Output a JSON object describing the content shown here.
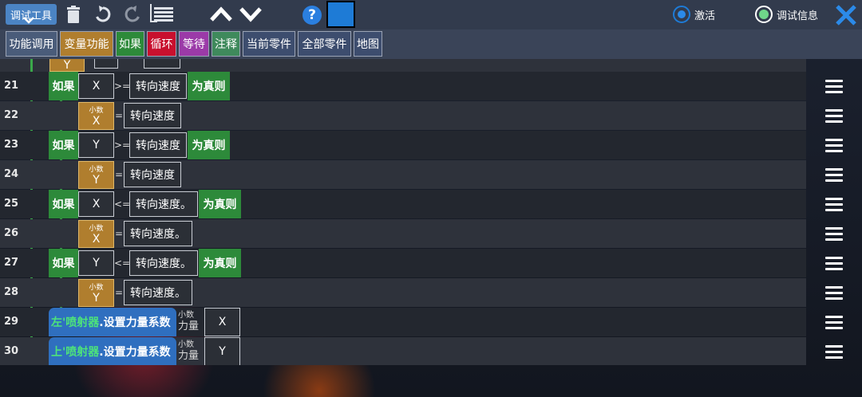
{
  "toolbar": {
    "toolbox_label": "调试工具",
    "activate_label": "激活",
    "debug_info_label": "调试信息",
    "accent_color": "#1e7bd6"
  },
  "categories": [
    {
      "label": "功能调用",
      "bg": "#4a5c7a"
    },
    {
      "label": "变量功能",
      "bg": "#b07e2e"
    },
    {
      "label": "如果",
      "bg": "#2d8a3a"
    },
    {
      "label": "循环",
      "bg": "#c8102e"
    },
    {
      "label": "等待",
      "bg": "#9b3aa8"
    },
    {
      "label": "注释",
      "bg": "#3f8a5c"
    },
    {
      "label": "当前零件",
      "bg": "#3d4d6e"
    },
    {
      "label": "全部零件",
      "bg": "#3d4d6e"
    },
    {
      "label": "地图",
      "bg": "#3d4d6e"
    }
  ],
  "partial_row": {
    "tag": "Y"
  },
  "rows": [
    {
      "num": "21",
      "kind": "if",
      "var": "X",
      "op": ">=",
      "value": "转向速度",
      "result": "为真则"
    },
    {
      "num": "22",
      "kind": "assign",
      "tag_top": "小数",
      "tag_var": "X",
      "op": "=",
      "value": "转向速度"
    },
    {
      "num": "23",
      "kind": "if",
      "var": "Y",
      "op": ">=",
      "value": "转向速度",
      "result": "为真则"
    },
    {
      "num": "24",
      "kind": "assign",
      "tag_top": "小数",
      "tag_var": "Y",
      "op": "=",
      "value": "转向速度"
    },
    {
      "num": "25",
      "kind": "if",
      "var": "X",
      "op": "<=",
      "value": "转向速度。",
      "result": "为真则"
    },
    {
      "num": "26",
      "kind": "assign",
      "tag_top": "小数",
      "tag_var": "X",
      "op": "=",
      "value": "转向速度。"
    },
    {
      "num": "27",
      "kind": "if",
      "var": "Y",
      "op": "<=",
      "value": "转向速度。",
      "result": "为真则"
    },
    {
      "num": "28",
      "kind": "assign",
      "tag_top": "小数",
      "tag_var": "Y",
      "op": "=",
      "value": "转向速度。"
    },
    {
      "num": "29",
      "kind": "call",
      "name": "左'喷射器",
      "method": ".设置力量系数",
      "p_top": "小数",
      "p_name": "力量",
      "arg": "X"
    },
    {
      "num": "30",
      "kind": "call",
      "name": "上'喷射器",
      "method": ".设置力量系数",
      "p_top": "小数",
      "p_name": "力量",
      "arg": "Y"
    }
  ],
  "if_keyword": "如果"
}
